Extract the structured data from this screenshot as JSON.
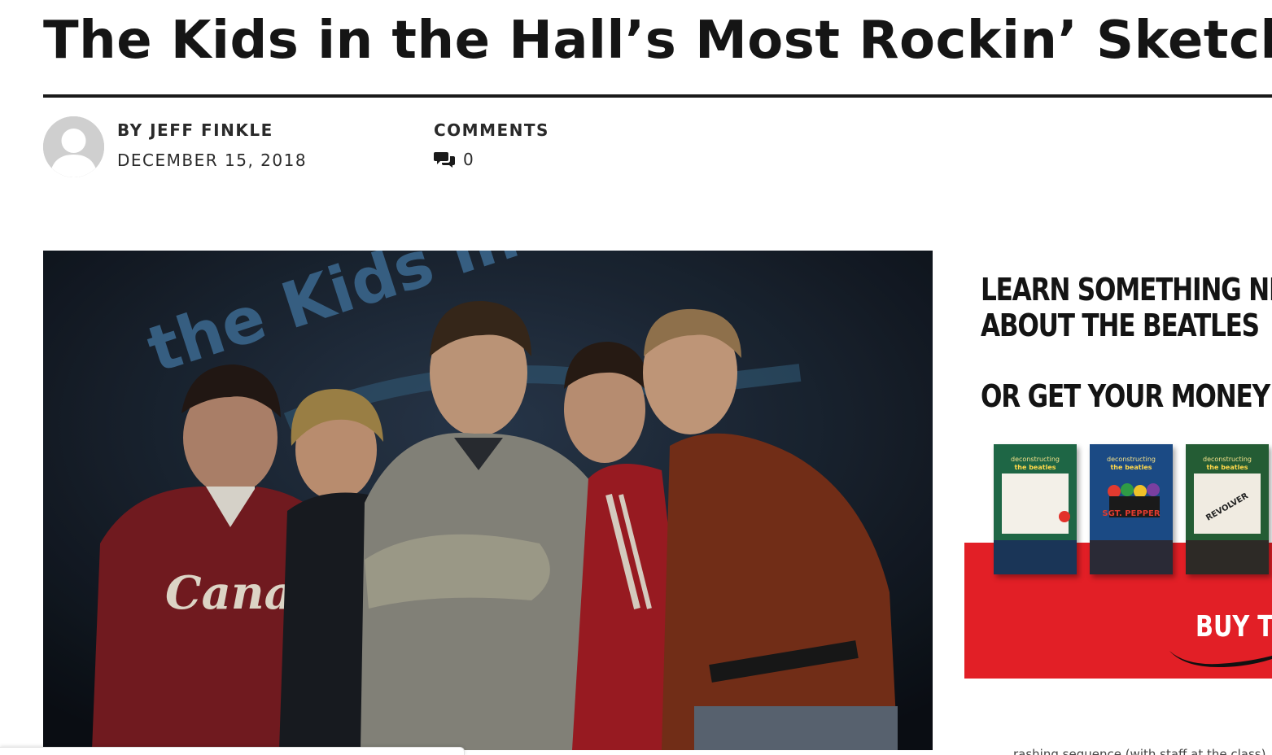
{
  "article": {
    "title": "The Kids in the Hall’s Most Rockin’ Sketches",
    "author": "BY JEFF FINKLE",
    "date": "DECEMBER 15, 2018",
    "comments_label": "COMMENTS",
    "comments_count": "0"
  },
  "hero": {
    "backdrop_text": "the Kids in the Hall",
    "sweatshirt_text": "Canada"
  },
  "ad": {
    "headline_line1": "LEARN SOMETHING NEW",
    "headline_line2": "ABOUT THE BEATLES",
    "money_back": "OR GET YOUR MONEY BAC",
    "cta": "BUY TH",
    "books": [
      {
        "series": "deconstructing",
        "sub": "the beatles",
        "name": "",
        "color": "#1f6b46"
      },
      {
        "series": "deconstructing",
        "sub": "the beatles",
        "name": "SGT. PEPPER",
        "color": "#1c4b86"
      },
      {
        "series": "deconstructing",
        "sub": "the beatles",
        "name": "REVOLVER",
        "color": "#1e5a33"
      }
    ],
    "accent_color": "#e21f26"
  },
  "footer_partial_text": "…rashing sequence (with staff at the class)…"
}
